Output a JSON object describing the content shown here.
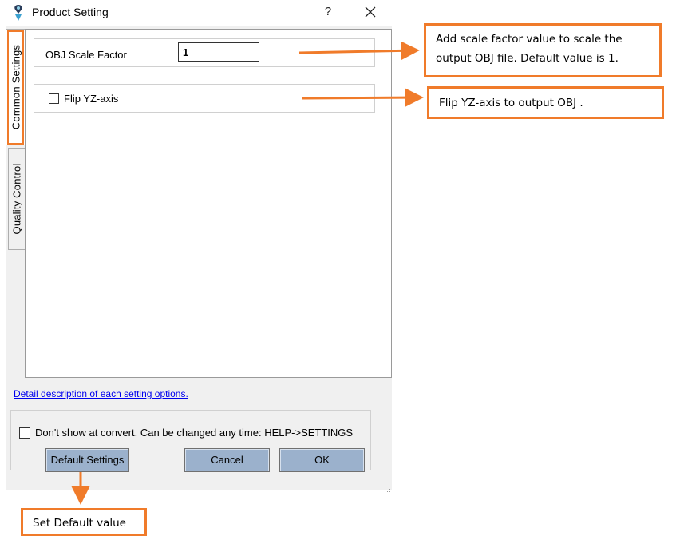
{
  "window": {
    "title": "Product Setting",
    "help_glyph": "?",
    "close_glyph": "✕"
  },
  "tabs": [
    {
      "label": "Common Settings"
    },
    {
      "label": "Quality Control"
    }
  ],
  "common_settings": {
    "scale_label": "OBJ Scale Factor",
    "scale_value": "1",
    "flip_label": "Flip YZ-axis",
    "flip_checked": false
  },
  "footer": {
    "detail_link": "Detail description of each setting options.",
    "dont_show_label": "Don't show at convert. Can be changed any time: HELP->SETTINGS",
    "default_button": "Default Settings",
    "cancel_button": "Cancel",
    "ok_button": "OK"
  },
  "annotations": {
    "scale_note": "Add scale factor value to scale the output OBJ file. Default value is 1.",
    "flip_note": "Flip YZ-axis to output OBJ .",
    "default_note": "Set Default value",
    "accent_color": "#f07b2a"
  },
  "colors": {
    "button_face": "#9bb1cc",
    "link": "#0000ee"
  }
}
